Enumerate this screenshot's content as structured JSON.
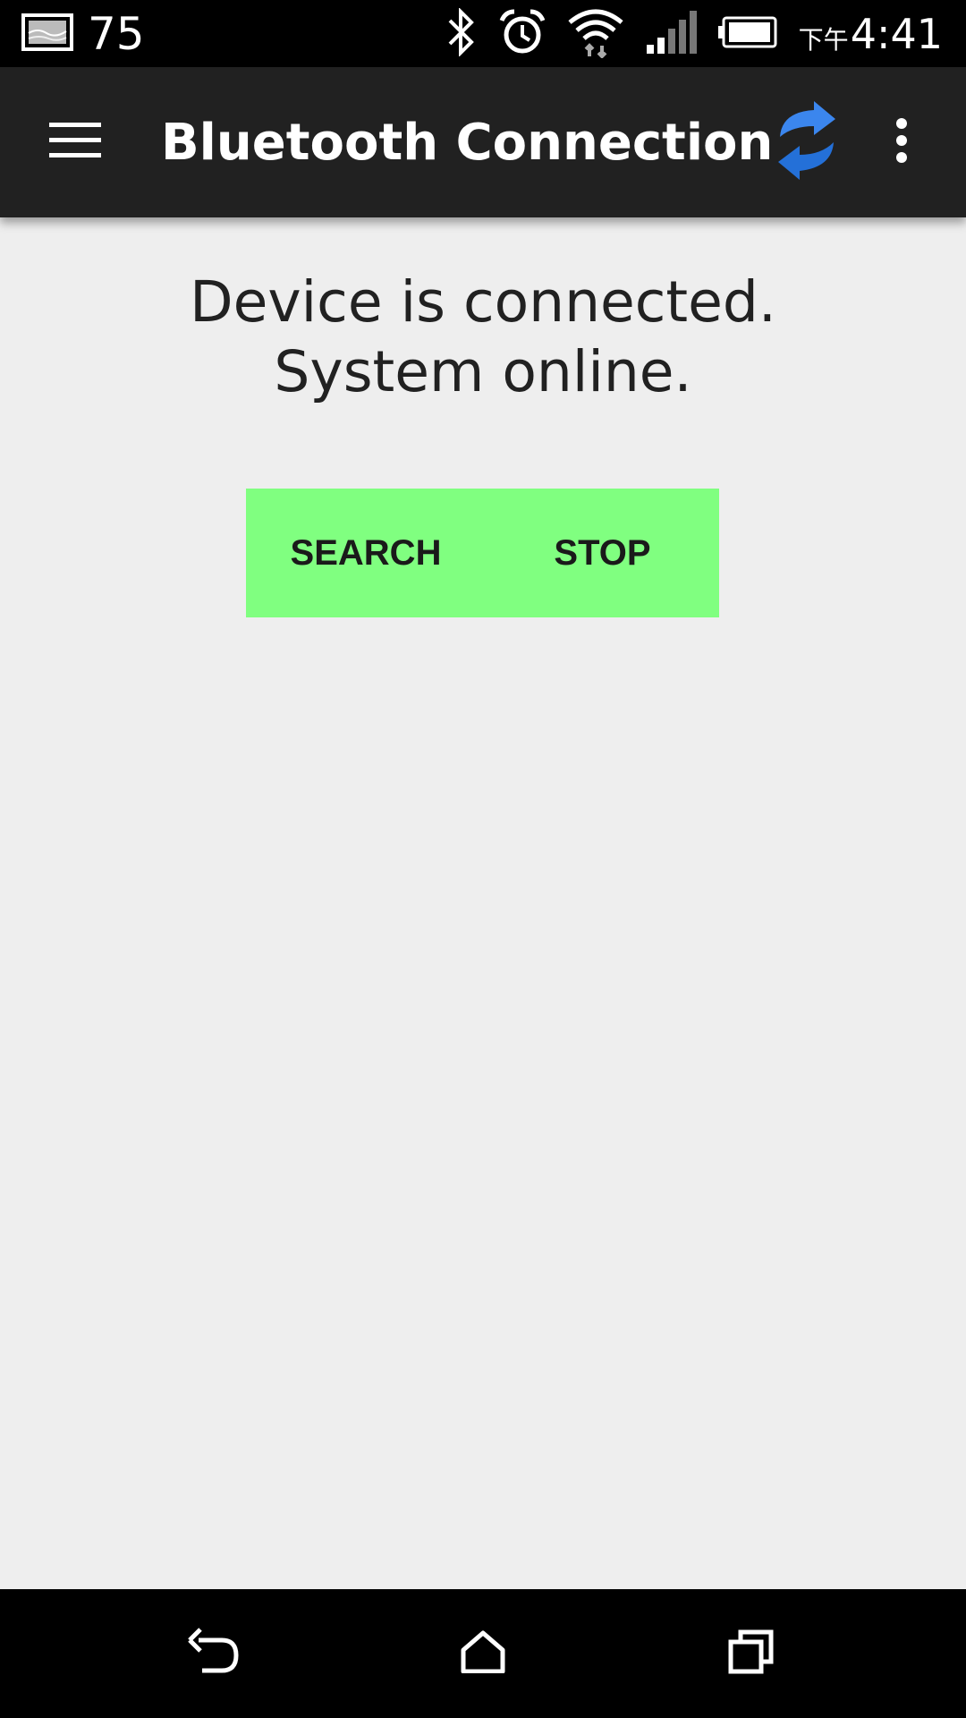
{
  "status_bar": {
    "notification_count": "75",
    "time_period": "下午",
    "time": "4:41",
    "icons": [
      "gallery-notification-icon",
      "bluetooth-icon",
      "alarm-icon",
      "wifi-icon",
      "signal-icon",
      "battery-icon"
    ]
  },
  "app_bar": {
    "title": "Bluetooth Connection",
    "background": "#212121",
    "icons": [
      "menu-icon",
      "refresh-icon",
      "overflow-menu-icon"
    ],
    "refresh_color": "#2f7de1"
  },
  "main": {
    "status_line1": "Device is connected.",
    "status_line2": "System online.",
    "buttons": {
      "search_label": "SEARCH",
      "stop_label": "STOP",
      "background": "#80ff80"
    }
  },
  "nav_bar": {
    "icons": [
      "back-icon",
      "home-icon",
      "recent-apps-icon"
    ]
  }
}
